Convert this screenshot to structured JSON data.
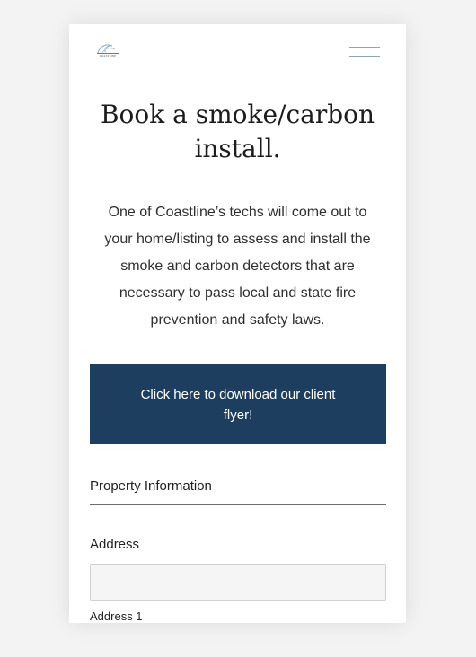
{
  "brand": {
    "logo_text": "COASTLINE",
    "accent_color": "#1e3e5f"
  },
  "header": {
    "menu_icon": "hamburger-menu-icon"
  },
  "main": {
    "title": "Book a smoke/carbon install.",
    "intro": "One of Coastline’s techs will come out to your home/listing to assess and install the smoke and carbon detectors that are necessary to pass local and state fire prevention and safety laws.",
    "flyer_button_label": "Click here to download our client flyer!"
  },
  "form": {
    "section_heading": "Property Information",
    "address_label": "Address",
    "address_value": "",
    "address_line1_label": "Address 1"
  }
}
